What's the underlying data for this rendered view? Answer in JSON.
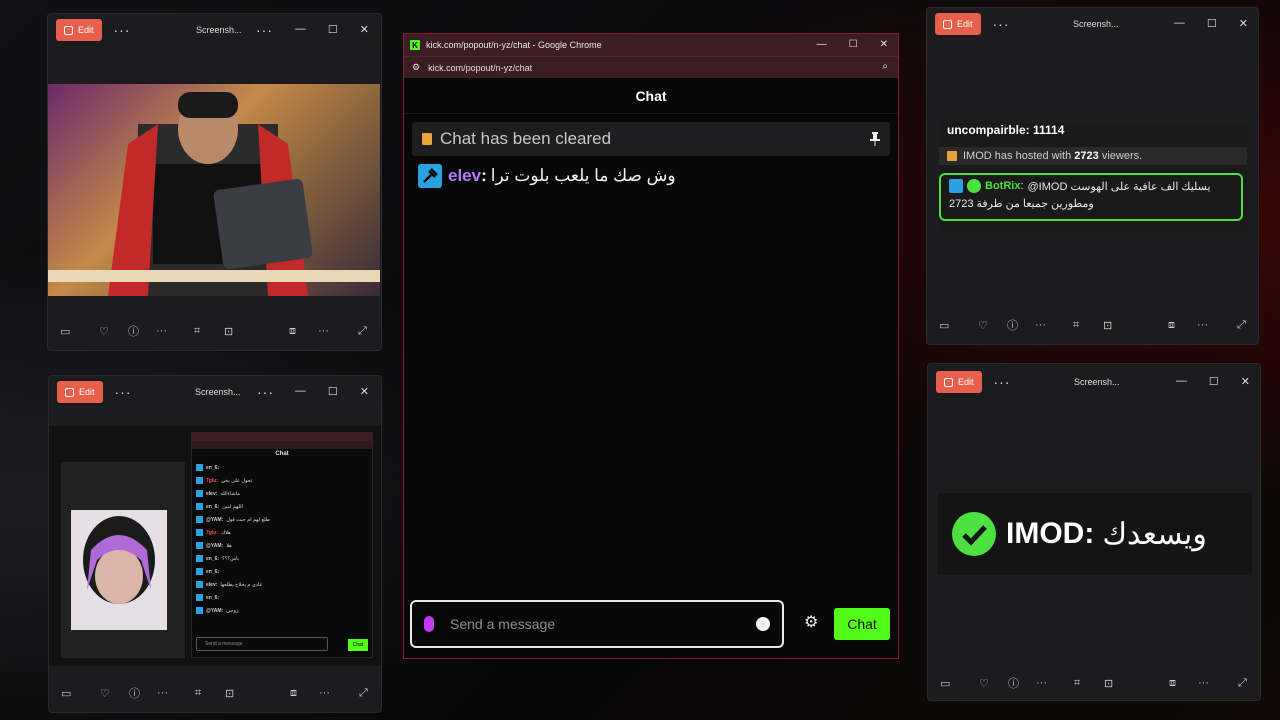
{
  "photos_common": {
    "edit_label": "Edit",
    "more_icon": "more-icon",
    "window_title": "Screensh...",
    "minimize": "—",
    "maximize": "☐",
    "close": "✕"
  },
  "chrome": {
    "title": "kick.com/popout/n-yz/chat - Google Chrome",
    "url": "kick.com/popout/n-yz/chat",
    "logo": "K",
    "minimize": "—",
    "maximize": "☐",
    "close": "✕"
  },
  "chat": {
    "header": "Chat",
    "cleared_text": "Chat has been cleared",
    "message": {
      "username": "elev",
      "separator": ":",
      "text": "وش صك ما يلعب بلوت ترا"
    },
    "input_placeholder": "Send a message",
    "send_label": "Chat"
  },
  "window_topright": {
    "line1": "uncompairble: 11114",
    "hosted": {
      "user": "IMOD",
      "pre": " has hosted with ",
      "count": "2723",
      "post": " viewers."
    },
    "botrix": {
      "user": "BotRix",
      "sep": ":",
      "text": "@IMOD يسليك الف عافية على الهوست",
      "text2": "2723 ومطورين جميعا من طرفة"
    }
  },
  "window_bottomright": {
    "user": "IMOD",
    "sep": ":",
    "text": "ويسعدك"
  },
  "window_bottomleft": {
    "mini_header": "Chat",
    "mini_lines": [
      {
        "user": "en_6",
        "text": ""
      },
      {
        "user": "7glu",
        "text": "تحول على يخي"
      },
      {
        "user": "elev",
        "text": "ماشاءالله"
      },
      {
        "user": "en_6",
        "text": "اللهم امين"
      },
      {
        "user": "@YAM",
        "text": "طلع لهم ام جنت قول"
      },
      {
        "user": "7glu",
        "text": "هلاك"
      },
      {
        "user": "@YAM",
        "text": "هلا"
      },
      {
        "user": "en_6",
        "text": "باس؟؟؟"
      },
      {
        "user": "en_6",
        "text": ""
      },
      {
        "user": "elev",
        "text": "عادي م يخلاح يطلعها"
      },
      {
        "user": "en_6",
        "text": ""
      },
      {
        "user": "@YAM",
        "text": "زوجي"
      }
    ],
    "mini_placeholder": "Send a message",
    "mini_send": "Chat"
  }
}
